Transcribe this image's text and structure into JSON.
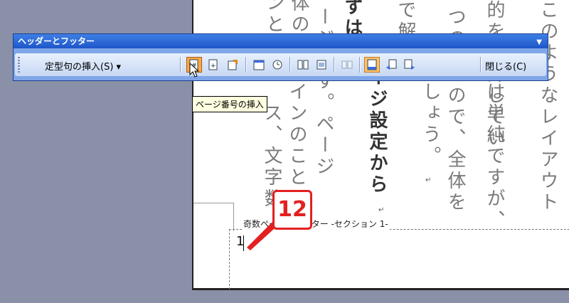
{
  "document": {
    "columns": [
      {
        "text": "ンとうお",
        "bold": false
      },
      {
        "text": "体のう",
        "bold": false
      },
      {
        "text": "ージです。ページ",
        "bold": false
      },
      {
        "text": "インのこと",
        "bold": false
      },
      {
        "text": "ス、文字数",
        "bold": false
      },
      {
        "text": "ずはペ",
        "bold": true
      },
      {
        "text": "ージ設定から",
        "bold": true
      },
      {
        "text": "で解",
        "bold": false
      },
      {
        "text": "ましょう。",
        "bold": false
      },
      {
        "text": "つの",
        "bold": false
      },
      {
        "text": "あので、全体を",
        "bold": false
      },
      {
        "text": "的を紹介してい",
        "bold": false
      },
      {
        "text": "は単純ですが、",
        "bold": false
      },
      {
        "text": "このようなレイアウト",
        "bold": false
      }
    ],
    "footer_label": "奇数ページのフッター -セクション 1-",
    "page_number": "1"
  },
  "toolbar": {
    "title": "ヘッダーとフッター",
    "autotext_label": "定型句の挿入(S) ▾",
    "close_label": "閉じる(C)",
    "icons": [
      "insert-page-number-icon",
      "insert-page-count-icon",
      "format-page-number-icon",
      "insert-date-icon",
      "insert-time-icon",
      "page-setup-icon",
      "show-hide-document-text-icon",
      "same-as-previous-icon",
      "switch-header-footer-icon",
      "show-previous-icon",
      "show-next-icon"
    ]
  },
  "tooltip": {
    "text": "ページ番号の挿入"
  },
  "annotation": {
    "step": "12"
  }
}
